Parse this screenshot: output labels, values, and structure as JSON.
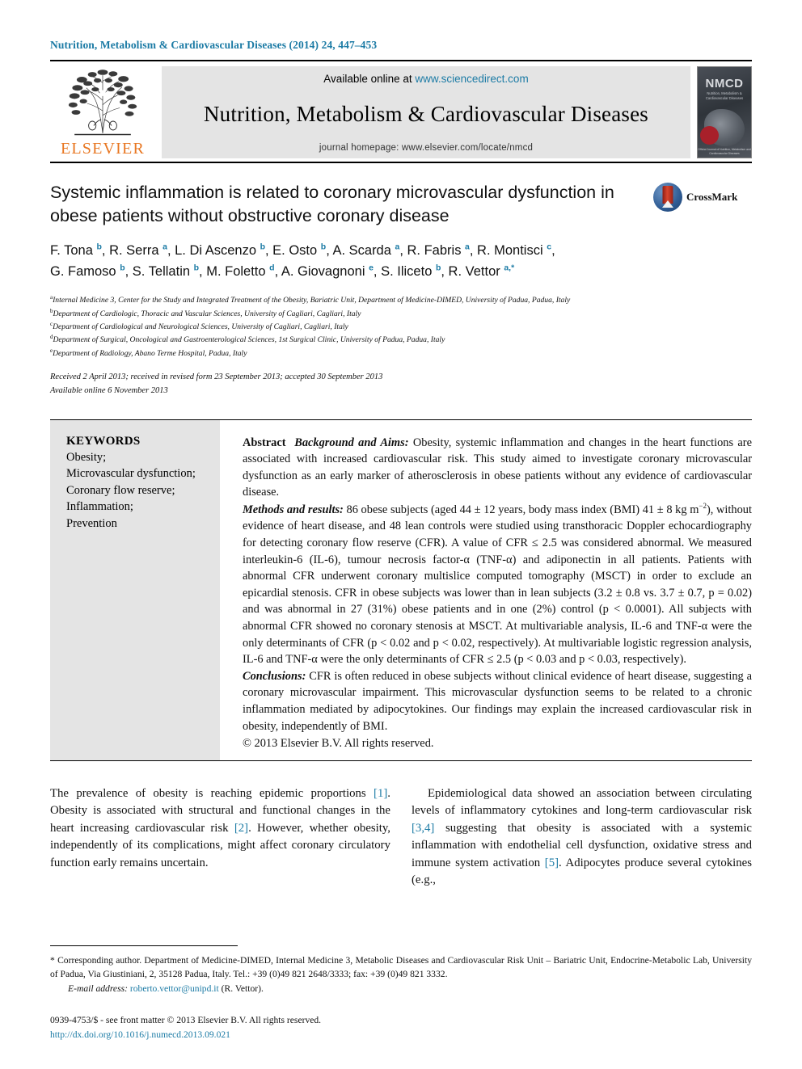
{
  "running_head": "Nutrition, Metabolism & Cardiovascular Diseases (2014) 24, 447–453",
  "masthead": {
    "publisher_word": "ELSEVIER",
    "available_prefix": "Available online at ",
    "available_link": "www.sciencedirect.com",
    "journal_name": "Nutrition, Metabolism & Cardiovascular Diseases",
    "homepage_line": "journal homepage: www.elsevier.com/locate/nmcd",
    "cover": {
      "acronym": "NMCD",
      "subtitle": "Nutrition, Metabolism &\nCardiovascular Diseases",
      "tagline": "A Journal of the Italian Society of Human Nutrition,\nItalian Society of Diabetology and Italian Society of Obesity",
      "foot": "Official Journal of\nNutrition, Metabolism and\nCardiovascular Diseases"
    }
  },
  "article": {
    "title": "Systemic inflammation is related to coronary microvascular dysfunction in obese patients without obstructive coronary disease",
    "crossmark_label": "CrossMark",
    "authors_line_1": [
      {
        "name": "F. Tona ",
        "sup": "b"
      },
      {
        "name": ", R. Serra ",
        "sup": "a"
      },
      {
        "name": ", L. Di Ascenzo ",
        "sup": "b"
      },
      {
        "name": ", E. Osto ",
        "sup": "b"
      },
      {
        "name": ", A. Scarda ",
        "sup": "a"
      },
      {
        "name": ", R. Fabris ",
        "sup": "a"
      },
      {
        "name": ", R. Montisci ",
        "sup": "c"
      },
      {
        "name": ",",
        "sup": ""
      }
    ],
    "authors_line_2": [
      {
        "name": "G. Famoso ",
        "sup": "b"
      },
      {
        "name": ", S. Tellatin ",
        "sup": "b"
      },
      {
        "name": ", M. Foletto ",
        "sup": "d"
      },
      {
        "name": ", A. Giovagnoni ",
        "sup": "e"
      },
      {
        "name": ", S. Iliceto ",
        "sup": "b"
      },
      {
        "name": ", R. Vettor ",
        "sup": "a,*"
      }
    ],
    "affiliations": [
      {
        "marker": "a",
        "text": "Internal Medicine 3, Center for the Study and Integrated Treatment of the Obesity, Bariatric Unit, Department of Medicine-DIMED, University of Padua, Padua, Italy"
      },
      {
        "marker": "b",
        "text": "Department of Cardiologic, Thoracic and Vascular Sciences, University of Cagliari, Cagliari, Italy"
      },
      {
        "marker": "c",
        "text": "Department of Cardiological and Neurological Sciences, University of Cagliari, Cagliari, Italy"
      },
      {
        "marker": "d",
        "text": "Department of Surgical, Oncological and Gastroenterological Sciences, 1st Surgical Clinic, University of Padua, Padua, Italy"
      },
      {
        "marker": "e",
        "text": "Department of Radiology, Abano Terme Hospital, Padua, Italy"
      }
    ],
    "history": {
      "received": "Received 2 April 2013; received in revised form 23 September 2013; accepted 30 September 2013",
      "online": "Available online 6 November 2013"
    }
  },
  "keywords": {
    "heading": "KEYWORDS",
    "list": "Obesity;\nMicrovascular dysfunction;\nCoronary flow reserve;\nInflammation;\nPrevention"
  },
  "abstract": {
    "label": "Abstract",
    "background_label": "Background and Aims:",
    "background_text": " Obesity, systemic inflammation and changes in the heart functions are associated with increased cardiovascular risk. This study aimed to investigate coronary microvascular dysfunction as an early marker of atherosclerosis in obese patients without any evidence of cardiovascular disease.",
    "methods_label": "Methods and results:",
    "methods_text_a": " 86 obese subjects (aged 44 ± 12 years, body mass index (BMI) 41 ± 8 kg m",
    "methods_sup": "−2",
    "methods_text_b": "), without evidence of heart disease, and 48 lean controls were studied using transthoracic Doppler echocardiography for detecting coronary flow reserve (CFR). A value of CFR ≤ 2.5 was considered abnormal. We measured interleukin-6 (IL-6), tumour necrosis factor-α (TNF-α) and adiponectin in all patients. Patients with abnormal CFR underwent coronary multislice computed tomography (MSCT) in order to exclude an epicardial stenosis. CFR in obese subjects was lower than in lean subjects (3.2 ± 0.8 vs. 3.7 ± 0.7, p = 0.02) and was abnormal in 27 (31%) obese patients and in one (2%) control (p < 0.0001). All subjects with abnormal CFR showed no coronary stenosis at MSCT. At multivariable analysis, IL-6 and TNF-α were the only determinants of CFR (p < 0.02 and p < 0.02, respectively). At multivariable logistic regression analysis, IL-6 and TNF-α were the only determinants of CFR ≤ 2.5 (p < 0.03 and p < 0.03, respectively).",
    "conclusions_label": "Conclusions:",
    "conclusions_text": " CFR is often reduced in obese subjects without clinical evidence of heart disease, suggesting a coronary microvascular impairment. This microvascular dysfunction seems to be related to a chronic inflammation mediated by adipocytokines. Our findings may explain the increased cardiovascular risk in obesity, independently of BMI.",
    "copyright": "© 2013 Elsevier B.V. All rights reserved."
  },
  "body": {
    "left_paragraph": {
      "t1": "The prevalence of obesity is reaching epidemic proportions ",
      "r1": "[1]",
      "t2": ". Obesity is associated with structural and functional changes in the heart increasing cardiovascular risk ",
      "r2": "[2]",
      "t3": ". However, whether obesity, independently of its complications, might affect coronary circulatory function early remains uncertain."
    },
    "right_paragraph": {
      "t1": "Epidemiological data showed an association between circulating levels of inflammatory cytokines and long-term cardiovascular risk ",
      "r1": "[3,4]",
      "t2": " suggesting that obesity is associated with a systemic inflammation with endothelial cell dysfunction, oxidative stress and immune system activation ",
      "r2": "[5]",
      "t3": ". Adipocytes produce several cytokines (e.g.,"
    }
  },
  "footer": {
    "corresponding": "* Corresponding author. Department of Medicine-DIMED, Internal Medicine 3, Metabolic Diseases and Cardiovascular Risk Unit – Bariatric Unit, Endocrine-Metabolic Lab, University of Padua, Via Giustiniani, 2, 35128 Padua, Italy. Tel.: +39 (0)49 821 2648/3333; fax: +39 (0)49 821 3332.",
    "email_label": "E-mail address:",
    "email": "roberto.vettor@unipd.it",
    "email_suffix": " (R. Vettor).",
    "issn_line": "0939-4753/$ - see front matter © 2013 Elsevier B.V. All rights reserved.",
    "doi": "http://dx.doi.org/10.1016/j.numecd.2013.09.021"
  },
  "colors": {
    "link": "#1c7ba5",
    "elsevier_orange": "#e87722",
    "keyword_panel": "#e4e4e4"
  }
}
